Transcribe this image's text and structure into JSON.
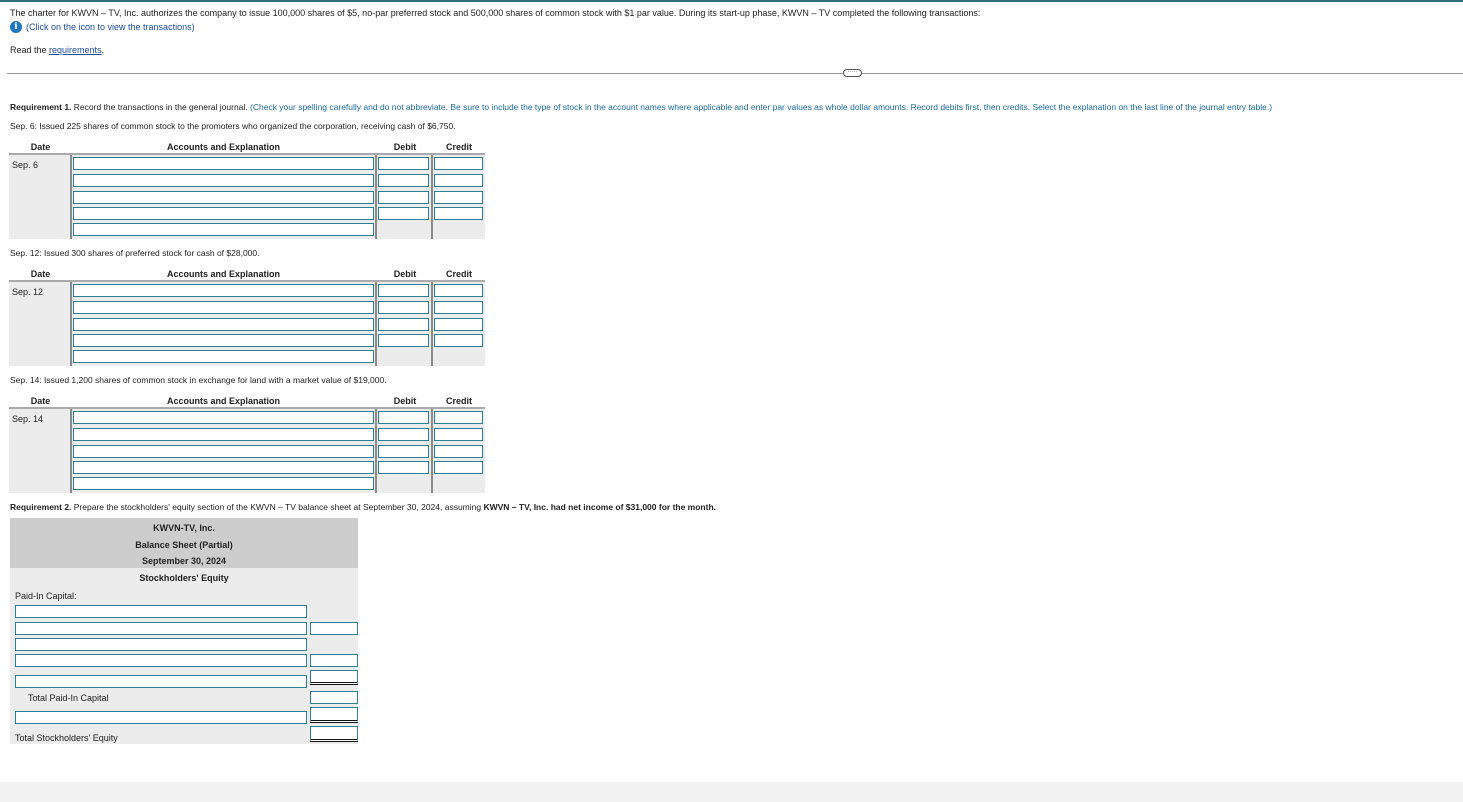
{
  "intro": "The charter for KWVN – TV, Inc. authorizes the company to issue 100,000 shares of $5, no-par preferred stock and 500,000 shares of common stock with $1 par value. During its start-up phase, KWVN – TV completed the following transactions:",
  "info_link": "(Click on the icon to view the transactions)",
  "read_prefix": "Read the ",
  "read_link": "requirements",
  "read_suffix": ".",
  "collapse_label": "·····",
  "req1": {
    "label": "Requirement 1.",
    "text": " Record the transactions in the general journal.",
    "instructions": " (Check your spelling carefully and do not abbreviate. Be sure to include the type of stock in the account names where applicable and enter par values as whole dollar amounts. Record debits first, then credits. Select the explanation on the last line of the journal entry table.)"
  },
  "table_headers": {
    "date": "Date",
    "accounts": "Accounts and Explanation",
    "debit": "Debit",
    "credit": "Credit"
  },
  "journals": [
    {
      "description": "Sep. 6: Issued 225 shares of common stock to the promoters who organized the corporation, receiving cash of $6,750.",
      "date": "Sep. 6"
    },
    {
      "description": "Sep. 12: Issued 300 shares of preferred stock for cash of $28,000.",
      "date": "Sep. 12"
    },
    {
      "description": "Sep. 14: Issued 1,200 shares of common stock in exchange for land with a market value of $19,000.",
      "date": "Sep. 14"
    }
  ],
  "req2": {
    "label": "Requirement 2.",
    "text": " Prepare the stockholders' equity section of the KWVN – TV balance sheet at September 30, 2024, assuming ",
    "bold": "KWVN – TV, Inc. had net income of $31,000 for the month."
  },
  "balance_sheet": {
    "company": "KWVN-TV, Inc.",
    "title": "Balance Sheet (Partial)",
    "date": "September 30, 2024",
    "section": "Stockholders' Equity",
    "paid_in_label": "Paid-In Capital:",
    "total_paid_in": "Total Paid-In Capital",
    "total_equity": "Total Stockholders' Equity"
  }
}
